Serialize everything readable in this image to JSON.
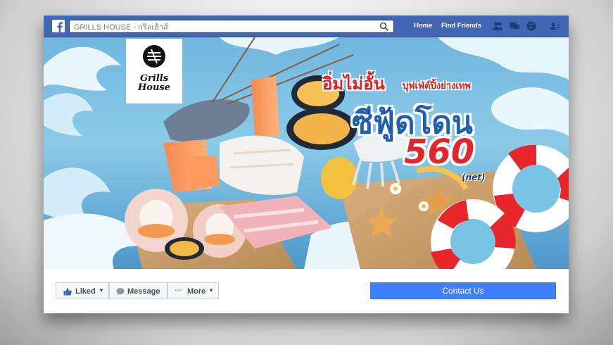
{
  "topbar": {
    "search_value": "GRILLS HOUSE - กริลเฮ้าส์",
    "nav_home": "Home",
    "nav_find_friends": "Find Friends"
  },
  "cover": {
    "logo_line1": "Grills",
    "logo_line2": "House",
    "headline_small_red": "อิ่มไม่อั้น",
    "headline_small_red_2": "บุฟเฟ่ต์ปิ้งย่างเทพ",
    "headline_big_blue": "ซีฟู้ดโดน",
    "price": "560",
    "price_note": "(net)"
  },
  "actions": {
    "liked_label": "Liked",
    "message_label": "Message",
    "more_label": "More",
    "contact_label": "Contact Us"
  },
  "colors": {
    "facebook_blue": "#4267b2",
    "contact_blue": "#4080ff",
    "headline_red": "#e02020",
    "headline_blue": "#1f5fae"
  }
}
